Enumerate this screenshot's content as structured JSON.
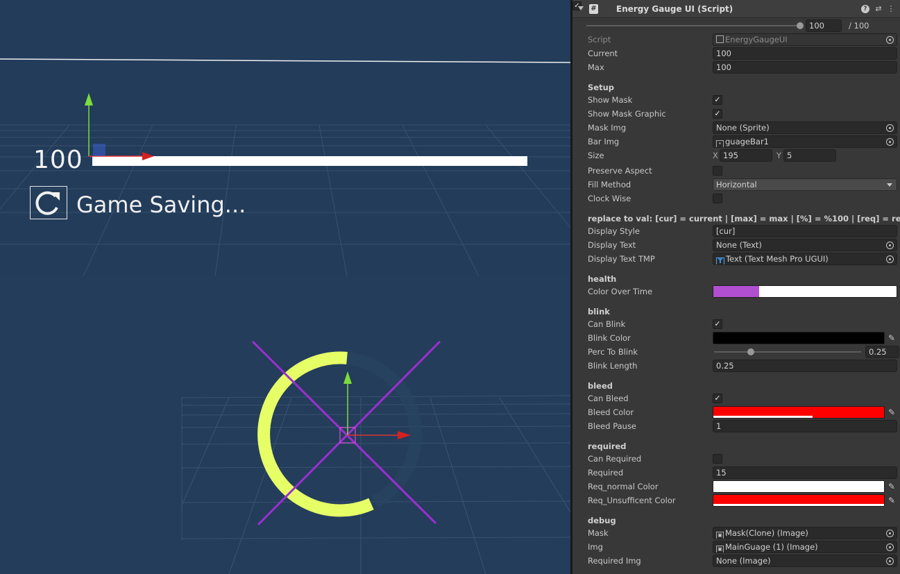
{
  "scene_top": {
    "gauge_value": "100",
    "saving_text": "Game Saving..."
  },
  "inspector": {
    "component_title": "Energy Gauge UI (Script)",
    "top_slider": {
      "value": "100",
      "max_label": "/ 100",
      "fraction": 1.0
    },
    "script": {
      "label": "Script",
      "value": "EnergyGaugeUI"
    },
    "current": {
      "label": "Current",
      "value": "100"
    },
    "max": {
      "label": "Max",
      "value": "100"
    },
    "setup": {
      "header": "Setup",
      "show_mask": {
        "label": "Show Mask",
        "checked": true
      },
      "show_mask_graphic": {
        "label": "Show Mask Graphic",
        "checked": true
      },
      "mask_img": {
        "label": "Mask Img",
        "value": "None (Sprite)"
      },
      "bar_img": {
        "label": "Bar Img",
        "value": "guageBar1"
      },
      "size": {
        "label": "Size",
        "x_label": "X",
        "x": "195",
        "y_label": "Y",
        "y": "5"
      },
      "preserve_aspect": {
        "label": "Preserve Aspect",
        "checked": false
      },
      "fill_method": {
        "label": "Fill Method",
        "value": "Horizontal"
      },
      "clock_wise": {
        "label": "Clock Wise",
        "checked": false
      }
    },
    "display": {
      "header": "replace to val: [cur] = current | [max] = max | [%] = %100 | [req] = re",
      "display_style": {
        "label": "Display Style",
        "value": "[cur]"
      },
      "display_text": {
        "label": "Display Text",
        "value": "None (Text)"
      },
      "display_text_tmp": {
        "label": "Display Text TMP",
        "value": "Text (Text Mesh Pro UGUI)"
      }
    },
    "health": {
      "header": "health",
      "color_over_time": {
        "label": "Color Over Time",
        "color": "#b24fd1",
        "fraction": 0.25
      }
    },
    "blink": {
      "header": "blink",
      "can_blink": {
        "label": "Can Blink",
        "checked": true
      },
      "blink_color": {
        "label": "Blink Color",
        "color": "#000000"
      },
      "perc_to_blink": {
        "label": "Perc To Blink",
        "value": "0.25",
        "fraction": 0.25
      },
      "blink_length": {
        "label": "Blink Length",
        "value": "0.25"
      }
    },
    "bleed": {
      "header": "bleed",
      "can_bleed": {
        "label": "Can Bleed",
        "checked": true
      },
      "bleed_color": {
        "label": "Bleed Color",
        "color": "#ff0000"
      },
      "bleed_pause": {
        "label": "Bleed Pause",
        "value": "1"
      }
    },
    "required": {
      "header": "required",
      "can_required": {
        "label": "Can Required",
        "checked": false
      },
      "required": {
        "label": "Required",
        "value": "15"
      },
      "req_normal_color": {
        "label": "Req_normal Color",
        "color": "#ffffff"
      },
      "req_unsufficent_color": {
        "label": "Req_Unsufficent Color",
        "color": "#ff0000"
      }
    },
    "debug": {
      "header": "debug",
      "mask": {
        "label": "Mask",
        "value": "Mask(Clone) (Image)"
      },
      "img": {
        "label": "Img",
        "value": "MainGuage (1) (Image)"
      },
      "required_img": {
        "label": "Required Img",
        "value": "None (Image)"
      }
    }
  }
}
